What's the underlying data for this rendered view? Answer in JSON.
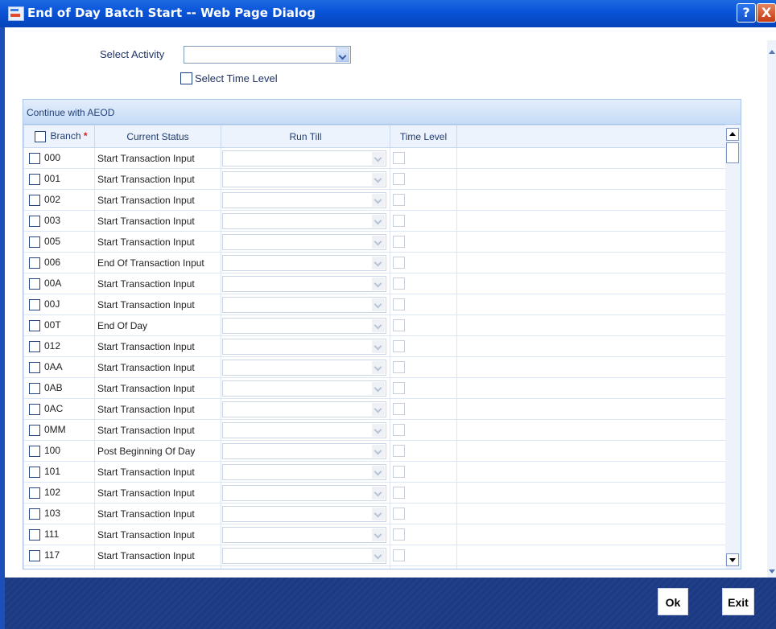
{
  "window": {
    "title": "End of Day Batch Start -- Web Page Dialog",
    "help_label": "?",
    "close_label": "X"
  },
  "activity": {
    "label": "Select Activity",
    "value": ""
  },
  "time_level_option": {
    "label": "Select Time Level",
    "checked": false
  },
  "panel": {
    "title": "Continue with AEOD"
  },
  "columns": {
    "branch": "Branch",
    "required_mark": "*",
    "status": "Current Status",
    "run_till": "Run Till",
    "time_level": "Time Level"
  },
  "rows": [
    {
      "branch": "000",
      "status": "Start Transaction Input"
    },
    {
      "branch": "001",
      "status": "Start Transaction Input"
    },
    {
      "branch": "002",
      "status": "Start Transaction Input"
    },
    {
      "branch": "003",
      "status": "Start Transaction Input"
    },
    {
      "branch": "005",
      "status": "Start Transaction Input"
    },
    {
      "branch": "006",
      "status": "End Of Transaction Input"
    },
    {
      "branch": "00A",
      "status": "Start Transaction Input"
    },
    {
      "branch": "00J",
      "status": "Start Transaction Input"
    },
    {
      "branch": "00T",
      "status": "End Of Day"
    },
    {
      "branch": "012",
      "status": "Start Transaction Input"
    },
    {
      "branch": "0AA",
      "status": "Start Transaction Input"
    },
    {
      "branch": "0AB",
      "status": "Start Transaction Input"
    },
    {
      "branch": "0AC",
      "status": "Start Transaction Input"
    },
    {
      "branch": "0MM",
      "status": "Start Transaction Input"
    },
    {
      "branch": "100",
      "status": "Post Beginning Of Day"
    },
    {
      "branch": "101",
      "status": "Start Transaction Input"
    },
    {
      "branch": "102",
      "status": "Start Transaction Input"
    },
    {
      "branch": "103",
      "status": "Start Transaction Input"
    },
    {
      "branch": "111",
      "status": "Start Transaction Input"
    },
    {
      "branch": "117",
      "status": "Start Transaction Input"
    },
    {
      "branch": "",
      "status": ""
    }
  ],
  "footer": {
    "ok_label": "Ok",
    "exit_label": "Exit"
  },
  "colors": {
    "title_bar": "#0a55d9",
    "footer": "#1c3a82",
    "header_bg": "#c6dbf6",
    "required": "#d61a1a"
  }
}
